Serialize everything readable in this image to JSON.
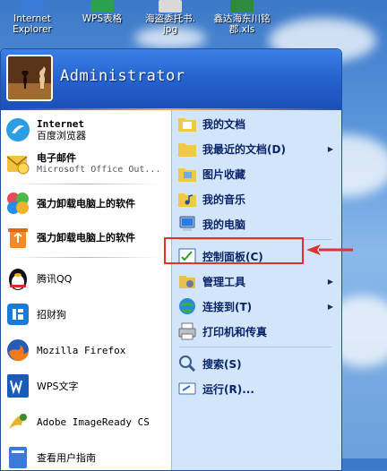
{
  "desktop": {
    "icons": [
      {
        "label_line1": "Internet",
        "label_line2": "Explorer",
        "color": "#3a7ad8"
      },
      {
        "label_line1": "WPS表格",
        "label_line2": "",
        "color": "#2aa14a"
      },
      {
        "label_line1": "海盗委托书.",
        "label_line2": "jpg",
        "color": "#d9d9d9"
      },
      {
        "label_line1": "鑫达海东川铭",
        "label_line2": "郡.xls",
        "color": "#2e8b3e"
      }
    ]
  },
  "start_menu": {
    "user_name": "Administrator",
    "pinned": [
      {
        "title": "Internet",
        "subtitle": "百度浏览器",
        "icon": "baidu-browser-icon"
      },
      {
        "title": "电子邮件",
        "subtitle": "Microsoft Office Out...",
        "icon": "outlook-icon"
      }
    ],
    "recent": [
      {
        "label": "强力卸载电脑上的软件",
        "icon": "uninstall-flower-icon"
      },
      {
        "label": "强力卸载电脑上的软件",
        "icon": "uninstall-recycle-icon"
      },
      {
        "label": "腾讯QQ",
        "icon": "qq-penguin-icon"
      },
      {
        "label": "招财狗",
        "icon": "zhaocaigou-icon"
      },
      {
        "label": "Mozilla Firefox",
        "icon": "firefox-icon"
      },
      {
        "label": "WPS文字",
        "icon": "wps-writer-icon"
      },
      {
        "label": "Adobe ImageReady CS",
        "icon": "imageready-icon"
      },
      {
        "label": "查看用户指南",
        "icon": "user-guide-icon"
      }
    ],
    "right": [
      {
        "label": "我的文档",
        "icon": "my-documents-icon",
        "submenu": false
      },
      {
        "label": "我最近的文档(D)",
        "icon": "recent-documents-icon",
        "submenu": true
      },
      {
        "label": "图片收藏",
        "icon": "my-pictures-icon",
        "submenu": false
      },
      {
        "label": "我的音乐",
        "icon": "my-music-icon",
        "submenu": false
      },
      {
        "label": "我的电脑",
        "icon": "my-computer-icon",
        "submenu": false
      },
      {
        "label": "控制面板(C)",
        "icon": "control-panel-icon",
        "submenu": false
      },
      {
        "label": "管理工具",
        "icon": "admin-tools-icon",
        "submenu": true
      },
      {
        "label": "连接到(T)",
        "icon": "connect-to-icon",
        "submenu": true
      },
      {
        "label": "打印机和传真",
        "icon": "printers-icon",
        "submenu": false
      },
      {
        "label": "搜索(S)",
        "icon": "search-icon",
        "submenu": false
      },
      {
        "label": "运行(R)...",
        "icon": "run-icon",
        "submenu": false
      }
    ]
  },
  "annotation": {
    "highlight_color": "#e03030"
  }
}
